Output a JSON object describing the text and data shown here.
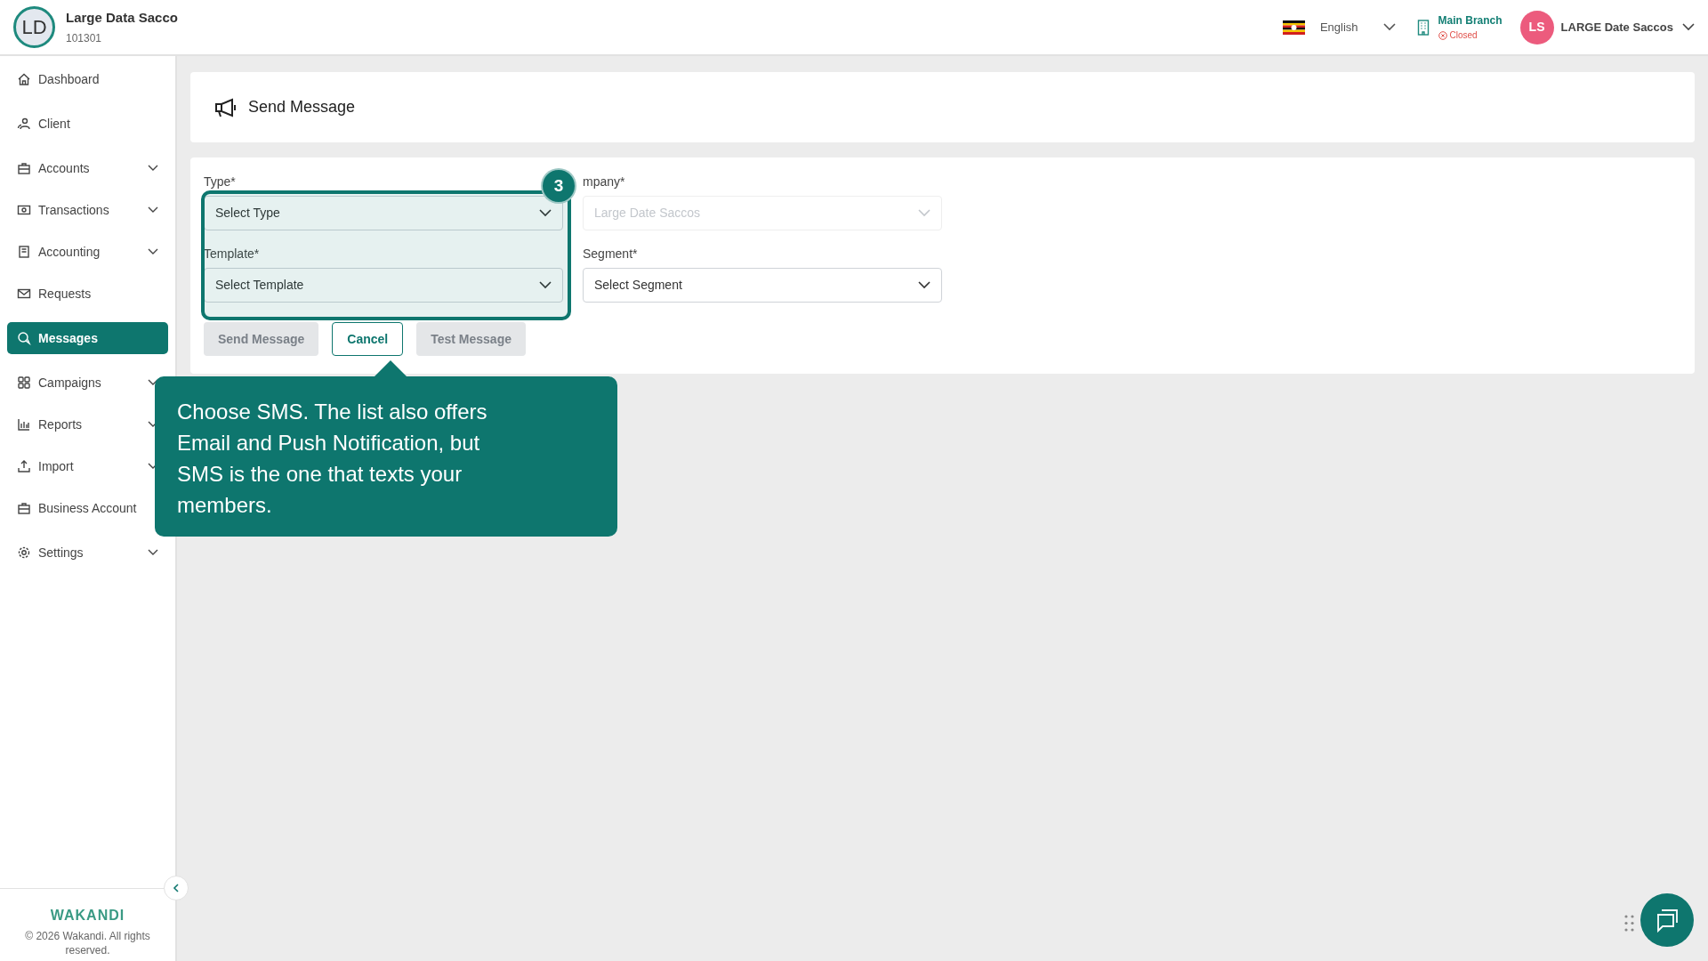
{
  "header": {
    "org_initials": "LD",
    "org_name": "Large Data Sacco",
    "org_code": "101301",
    "language": "English",
    "branch": {
      "name": "Main Branch",
      "status": "Closed"
    },
    "user": {
      "initials": "LS",
      "name": "LARGE Date Saccos"
    }
  },
  "sidebar": {
    "items": [
      {
        "label": "Dashboard",
        "selected": false,
        "expandable": false
      },
      {
        "label": "Client",
        "selected": false,
        "expandable": false
      },
      {
        "label": "Accounts",
        "selected": false,
        "expandable": true
      },
      {
        "label": "Transactions",
        "selected": false,
        "expandable": true
      },
      {
        "label": "Accounting",
        "selected": false,
        "expandable": true
      },
      {
        "label": "Requests",
        "selected": false,
        "expandable": false
      },
      {
        "label": "Messages",
        "selected": true,
        "expandable": false
      },
      {
        "label": "Campaigns",
        "selected": false,
        "expandable": true
      },
      {
        "label": "Reports",
        "selected": false,
        "expandable": true
      },
      {
        "label": "Import",
        "selected": false,
        "expandable": true
      },
      {
        "label": "Business Account",
        "selected": false,
        "expandable": false
      },
      {
        "label": "Settings",
        "selected": false,
        "expandable": true
      }
    ],
    "logo": "WAKANDI",
    "copyright": "© 2026 Wakandi. All rights reserved."
  },
  "page": {
    "title": "Send Message"
  },
  "form": {
    "fields": [
      {
        "label": "Type*",
        "value": "Select Type",
        "disabled": false
      },
      {
        "label": "mpany*",
        "value": "Large Date Saccos",
        "disabled": true
      },
      {
        "label": "Template*",
        "value": "Select Template",
        "disabled": false
      },
      {
        "label": "Segment*",
        "value": "Select Segment",
        "disabled": false
      }
    ],
    "buttons": [
      {
        "label": "Send Message",
        "kind": "filled",
        "disabled": true
      },
      {
        "label": "Cancel",
        "kind": "outline",
        "disabled": false
      },
      {
        "label": "Test Message",
        "kind": "filled",
        "disabled": true
      }
    ]
  },
  "tour": {
    "step": "3",
    "text": "Choose SMS. The list also offers Email and Push Notification, but SMS is the one that texts your members."
  }
}
